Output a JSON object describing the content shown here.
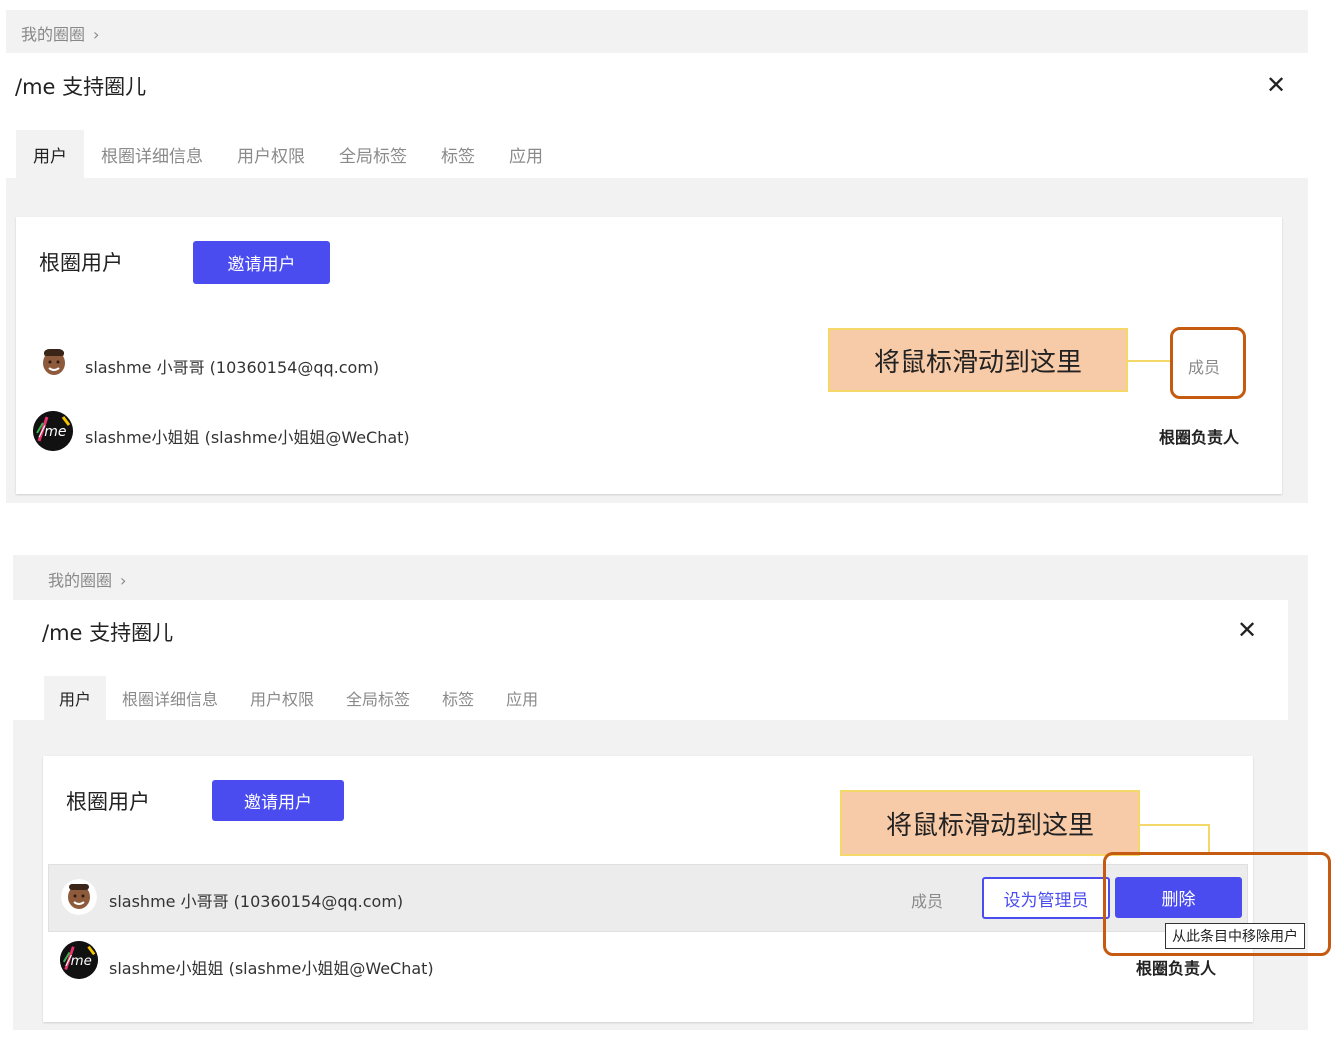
{
  "top": {
    "breadcrumb": "我的圈圈",
    "title": "/me 支持圈儿",
    "close": "✕",
    "tabs": [
      "用户",
      "根圈详细信息",
      "用户权限",
      "全局标签",
      "标签",
      "应用"
    ],
    "section_title": "根圈用户",
    "invite_label": "邀请用户",
    "users": [
      {
        "name": "slashme 小哥哥 (10360154@qq.com)",
        "role": "成员"
      },
      {
        "name": "slashme小姐姐 (slashme小姐姐@WeChat)",
        "role": "根圈负责人"
      }
    ],
    "callout": "将鼠标滑动到这里"
  },
  "bottom": {
    "breadcrumb": "我的圈圈",
    "title": "/me 支持圈儿",
    "close": "✕",
    "tabs": [
      "用户",
      "根圈详细信息",
      "用户权限",
      "全局标签",
      "标签",
      "应用"
    ],
    "section_title": "根圈用户",
    "invite_label": "邀请用户",
    "users": [
      {
        "name": "slashme 小哥哥 (10360154@qq.com)",
        "role": "成员"
      },
      {
        "name": "slashme小姐姐 (slashme小姐姐@WeChat)",
        "role": "根圈负责人"
      }
    ],
    "set_admin_label": "设为管理员",
    "delete_label": "删除",
    "tooltip": "从此条目中移除用户",
    "callout": "将鼠标滑动到这里"
  },
  "colors": {
    "primary": "#4a4cf0",
    "callout_bg": "#f8cba8",
    "highlight": "#c55a11"
  },
  "logo_text": "/me"
}
